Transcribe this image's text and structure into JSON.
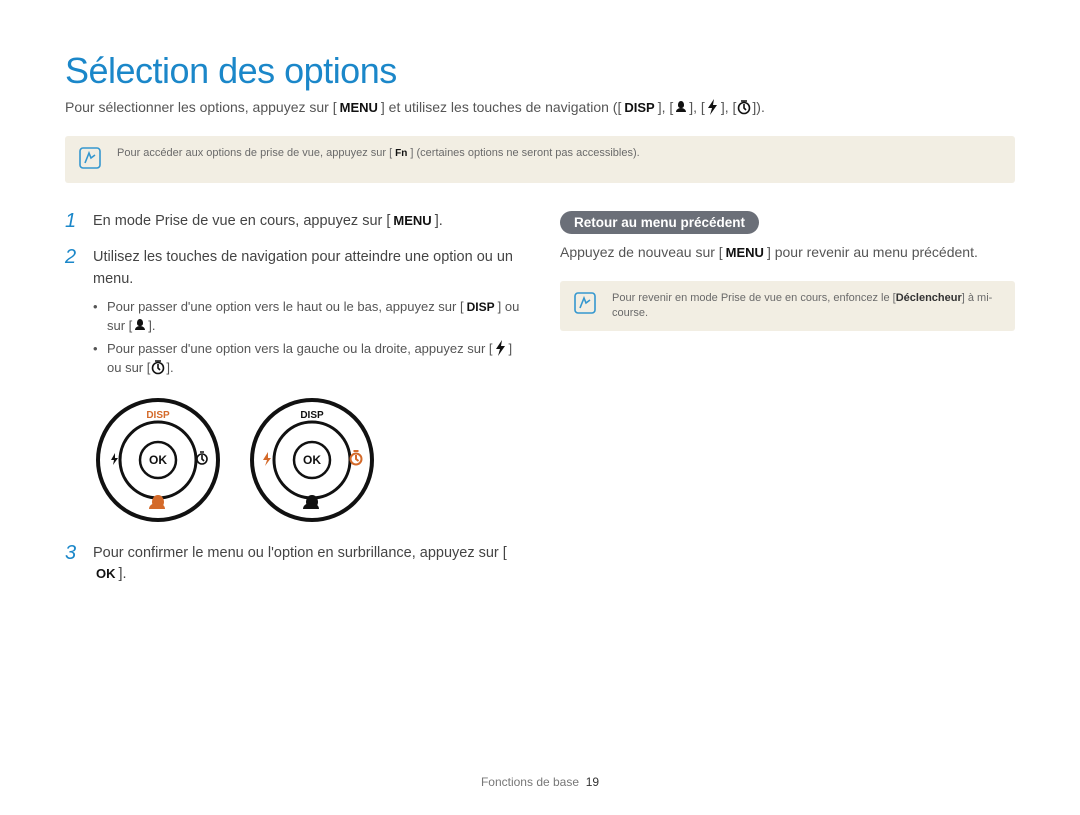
{
  "title": "Sélection des options",
  "intro": {
    "part1": "Pour sélectionner les options, appuyez sur [",
    "menu": "MENU",
    "part2": "] et utilisez les touches de navigation (["
  },
  "nav_keys": {
    "disp": "DISP"
  },
  "note1": {
    "before": "Pour accéder aux options de prise de vue, appuyez sur [",
    "fn": "Fn",
    "after": "] (certaines options ne seront pas accessibles)."
  },
  "steps": {
    "s1": {
      "num": "1",
      "text_before": "En mode Prise de vue en cours, appuyez sur [",
      "menu": "MENU",
      "text_after": "]."
    },
    "s2": {
      "num": "2",
      "line1": "Utilisez les touches de navigation pour atteindre une option ou un menu.",
      "sub1_a": "Pour passer d'une option vers le haut ou le bas, appuyez sur [",
      "sub1_disp": "DISP",
      "sub1_b": "] ou sur [",
      "sub1_c": "].",
      "sub2_a": "Pour passer d'une option vers la gauche ou la droite, appuyez sur [",
      "sub2_b": "] ou sur [",
      "sub2_c": "]."
    },
    "s3": {
      "num": "3",
      "text_a": "Pour confirmer le menu ou l'option en surbrillance, appuyez sur [",
      "ok": "OK",
      "text_b": "]."
    }
  },
  "dial": {
    "disp": "DISP",
    "ok": "OK"
  },
  "right": {
    "chip": "Retour au menu précédent",
    "para_a": "Appuyez de nouveau sur [",
    "menu": "MENU",
    "para_b": "] pour revenir au menu précédent.",
    "note_a": "Pour revenir en mode Prise de vue en cours, enfoncez le [",
    "note_bold": "Déclencheur",
    "note_b": "] à mi-course."
  },
  "footer": {
    "section": "Fonctions de base",
    "page": "19"
  }
}
